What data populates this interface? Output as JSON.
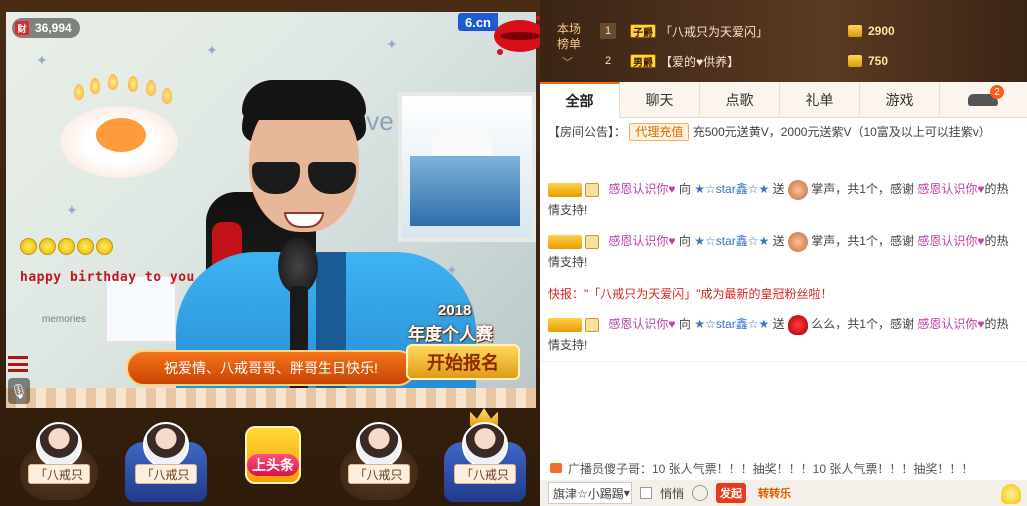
{
  "stream": {
    "viewer_icon": "财",
    "viewer_count": "36,994",
    "site_logo": "6.cn",
    "overlay_text": "happy birthday to you",
    "wall_text": "love",
    "photo_caption": "memories",
    "banner_text": "祝爱情、八戒哥哥、胖哥生日快乐!",
    "contest_year": "2018",
    "contest_title": "年度个人赛",
    "contest_button": "开始报名",
    "coin_count": 5
  },
  "seats": [
    {
      "type": "plain",
      "name": "「八戒只"
    },
    {
      "type": "sofa",
      "name": "「八戒只"
    },
    {
      "type": "headline",
      "name": "上头条"
    },
    {
      "type": "plain",
      "name": "「八戒只"
    },
    {
      "type": "sofa_crown",
      "name": "「八戒只"
    }
  ],
  "ranking": {
    "title": "本场榜单",
    "chevron": "﹀",
    "rows": [
      {
        "rank": "1",
        "badge": "子爵",
        "name": "「八戒只为天爱闪」",
        "score": "2900"
      },
      {
        "rank": "2",
        "badge": "男爵",
        "name": "【爱的♥供养】",
        "score": "750"
      }
    ]
  },
  "tabs": [
    "全部",
    "聊天",
    "点歌",
    "礼单",
    "游戏"
  ],
  "car_badge": "2",
  "chat": {
    "notice_label": "【房间公告】：",
    "notice_button": "代理充值",
    "notice_text": "充500元送黄V，2000元送紫V（10富及以上可以挂紫v）",
    "messages": [
      {
        "user": "感恩认识你♥",
        "to_word": "向",
        "target": "★☆star鑫☆★",
        "send_word": "送",
        "gift": "掌声，共1个，感谢",
        "thank_user": "感恩认识你♥",
        "end": "的热情支持!"
      },
      {
        "user": "感恩认识你♥",
        "to_word": "向",
        "target": "★☆star鑫☆★",
        "send_word": "送",
        "gift": "掌声，共1个，感谢",
        "thank_user": "感恩认识你♥",
        "end": "的热情支持!"
      },
      {
        "user": "感恩认识你♥",
        "to_word": "向",
        "target": "★☆star鑫☆★",
        "send_word": "送",
        "gift": "么么，共1个，感谢",
        "thank_user": "感恩认识你♥",
        "end": "的热情支持!"
      }
    ],
    "flash": "快报：\"「八戒只为天爱闪」\"成为最新的皇冠粉丝啦！"
  },
  "anchor_msg": "广播员傻子哥：10 张人气票！！！抽奖！！！10 张人气票！！！抽奖！！！",
  "input": {
    "select_value": "旗津☆小踢踢",
    "quiet_label": "悄悄",
    "btn1": "发起",
    "btn2": "转转乐"
  }
}
